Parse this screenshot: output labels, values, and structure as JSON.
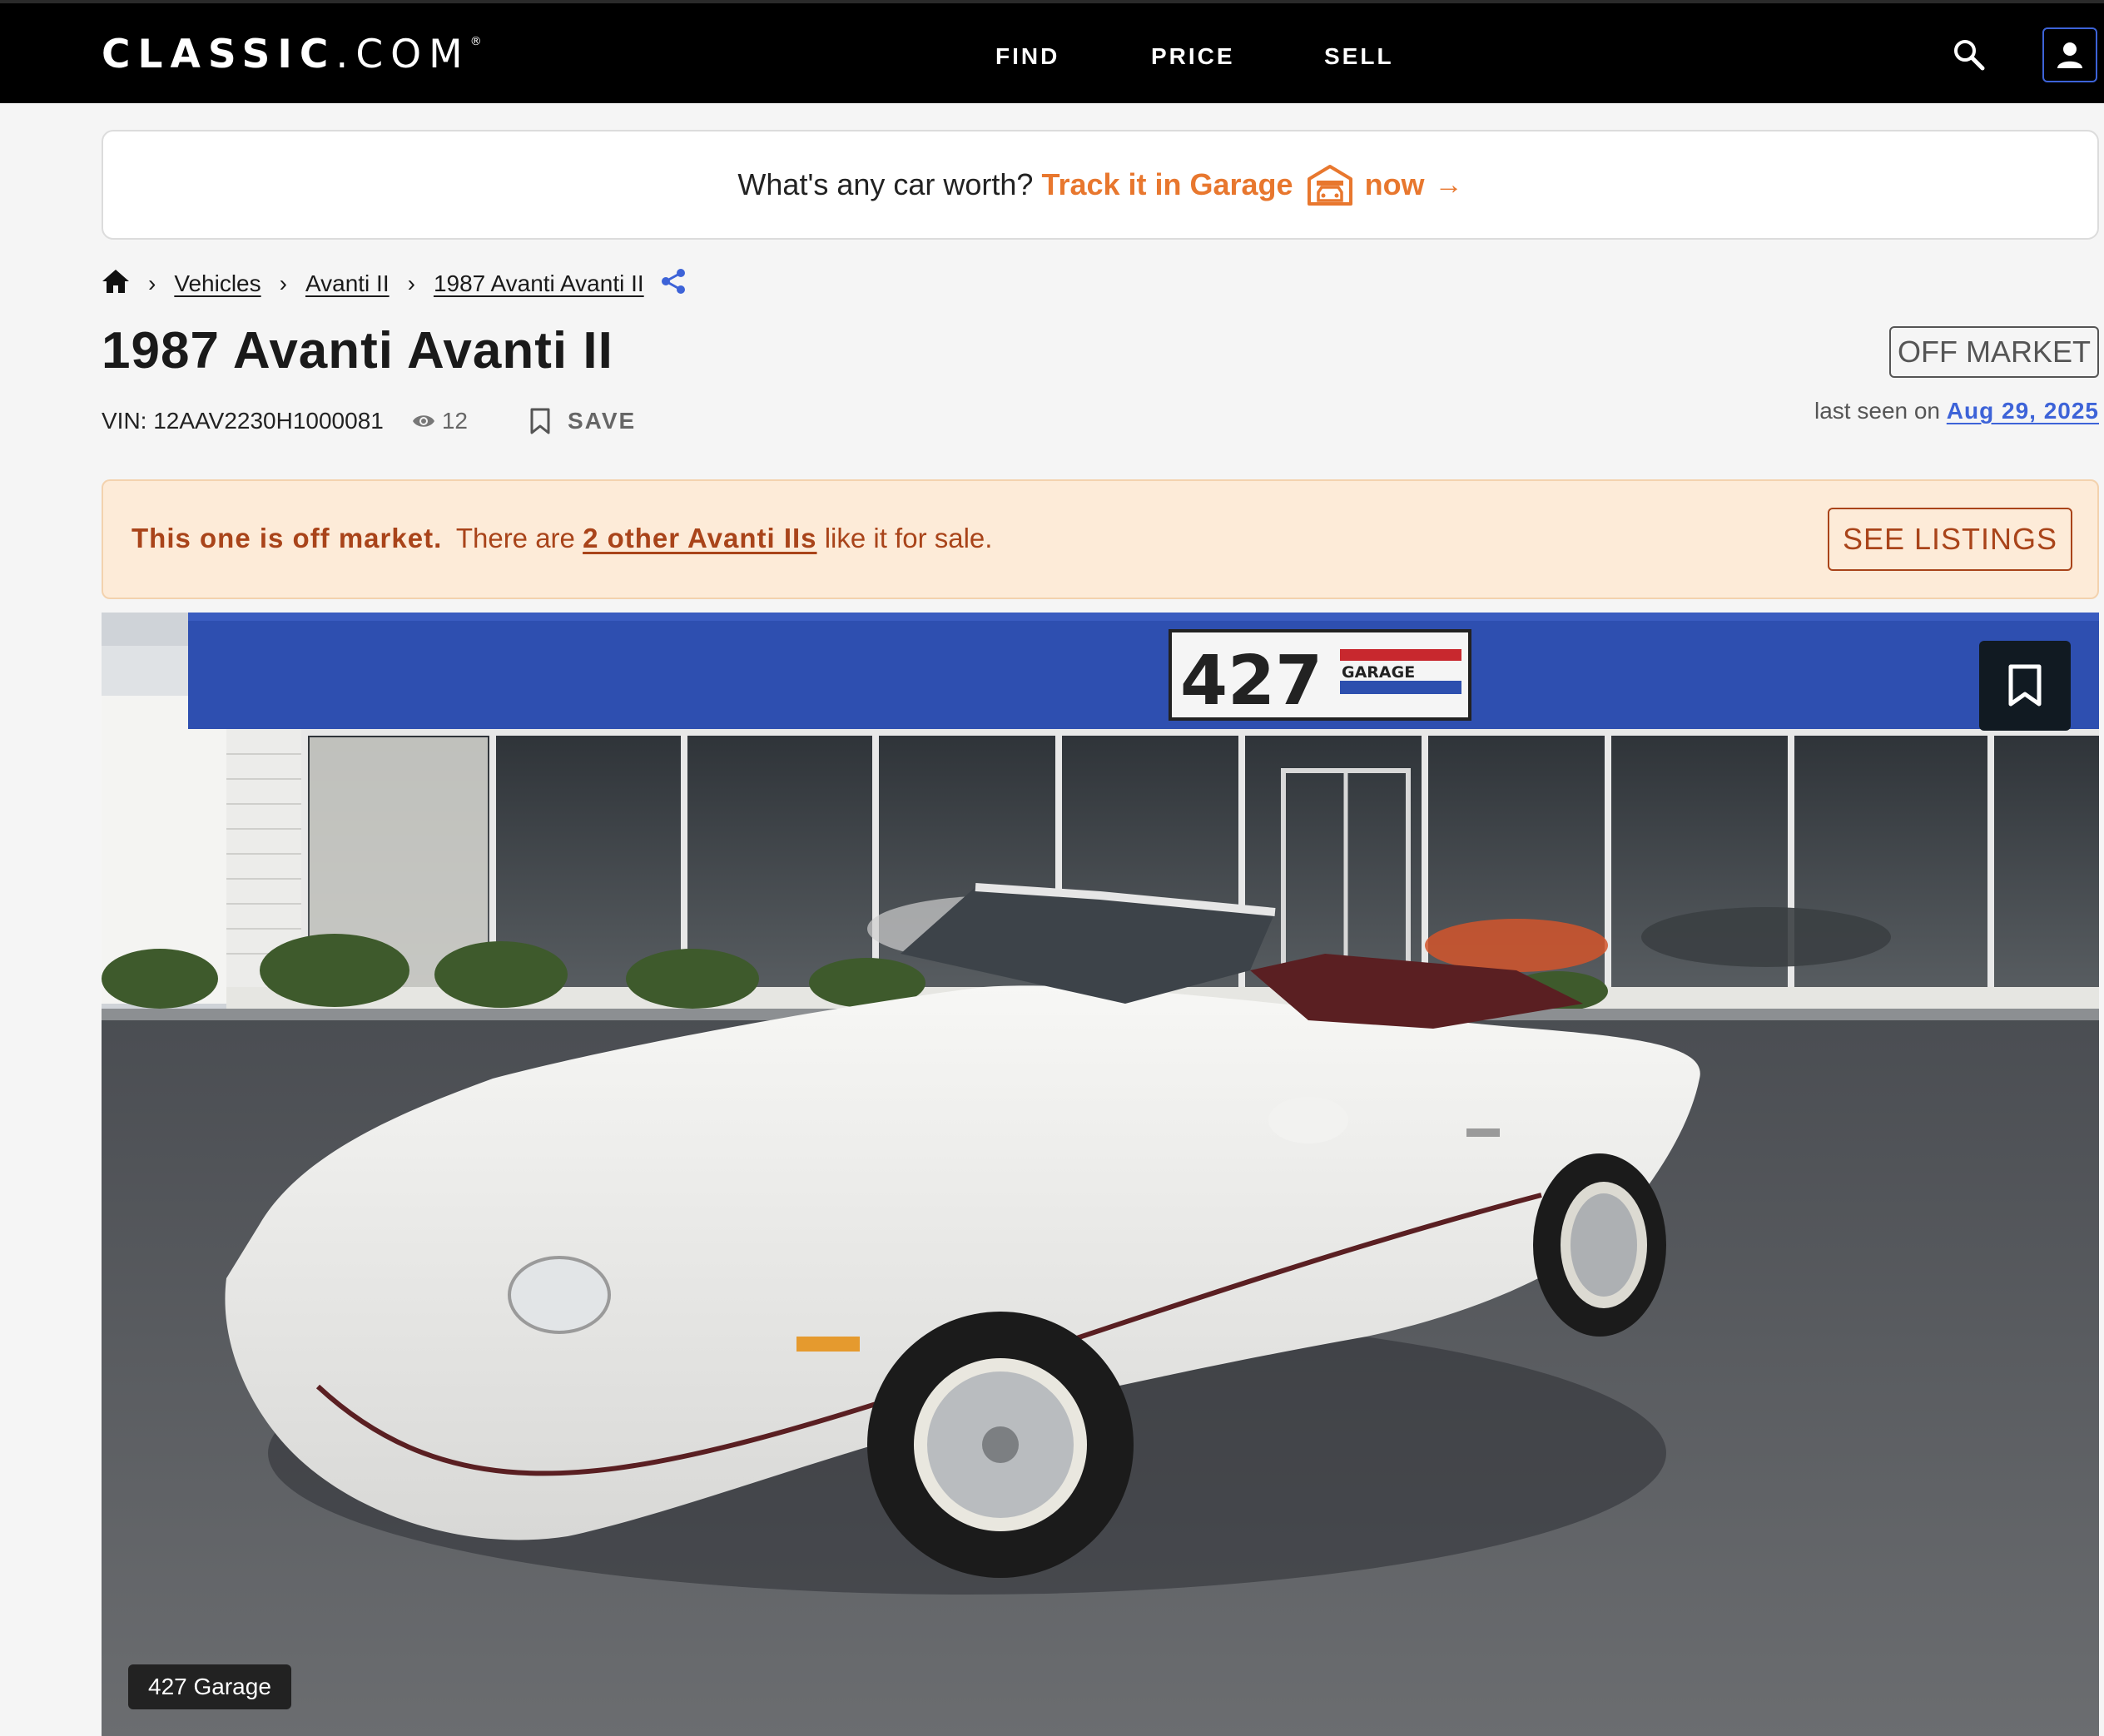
{
  "nav": {
    "logo_brand": "CLASSIC",
    "logo_suffix": ".COM",
    "logo_mark": "®",
    "links": [
      "FIND",
      "PRICE",
      "SELL"
    ]
  },
  "promo": {
    "question": "What's any car worth?",
    "cta": "Track it in Garage",
    "cta_suffix": "now",
    "arrow": "→"
  },
  "breadcrumb": {
    "items": [
      "Vehicles",
      "Avanti II",
      "1987 Avanti Avanti II"
    ]
  },
  "listing": {
    "title": "1987 Avanti Avanti II",
    "status": "OFF MARKET",
    "vin_label": "VIN: 12AAV2230H1000081",
    "views": "12",
    "save_label": "SAVE",
    "last_seen_prefix": "last seen on",
    "last_seen_date": "Aug 29, 2025"
  },
  "alert": {
    "bold": "This one is off market.",
    "prefix": "There are",
    "link": "2 other Avanti IIs",
    "suffix": "like it for sale.",
    "button": "SEE LISTINGS"
  },
  "photo": {
    "sign_number": "427",
    "sign_word": "GARAGE",
    "credit": "427 Garage"
  },
  "colors": {
    "accent_orange": "#e8772e",
    "link_blue": "#3d63d8",
    "alert_bg": "#fdebd8",
    "alert_text": "#a9441a"
  }
}
